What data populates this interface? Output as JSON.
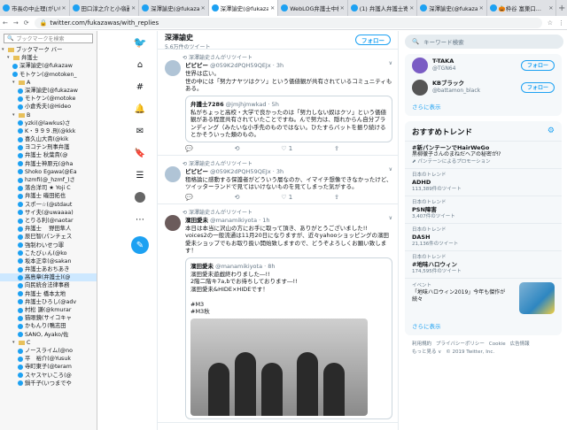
{
  "browser": {
    "tabs": [
      {
        "label": "市長の中止理(がいい"
      },
      {
        "label": "田口淳之介と小嶺麗..."
      },
      {
        "label": "深澤諭史(@fukazaw..."
      },
      {
        "label": "深澤諭史(@fukazaw..."
      },
      {
        "label": "WebLOG弁護士中村..."
      },
      {
        "label": "(1) 弁護人弁護士寄..."
      },
      {
        "label": "深澤諭史(@fukazaw..."
      },
      {
        "label": "🎃枠谷 富巣口..."
      }
    ],
    "url": "twitter.com/fukazawas/with_replies"
  },
  "bookmarks": {
    "search_placeholder": "ブックマークを検索",
    "items": [
      {
        "label": "ブックマーク バー",
        "type": "folder",
        "indent": 0
      },
      {
        "label": "弁護士",
        "type": "folder",
        "indent": 1
      },
      {
        "label": "深澤諭史(@fukazaw",
        "type": "link",
        "indent": 2
      },
      {
        "label": "モトケン(@motoken_",
        "type": "link",
        "indent": 2
      },
      {
        "label": "A",
        "type": "folder",
        "indent": 2
      },
      {
        "label": "深澤諭史(@fukazaw",
        "type": "link",
        "indent": 3
      },
      {
        "label": "モトケン(@motoke",
        "type": "link",
        "indent": 3
      },
      {
        "label": "小倉秀夫(@Hideo",
        "type": "link",
        "indent": 3
      },
      {
        "label": "B",
        "type": "folder",
        "indent": 2
      },
      {
        "label": "yzki(@lawkus)さ",
        "type": "link",
        "indent": 3
      },
      {
        "label": "K・９９９.刑(@kkk",
        "type": "link",
        "indent": 3
      },
      {
        "label": "喜久山大貴(@kik",
        "type": "link",
        "indent": 3
      },
      {
        "label": "ヨコテン刑事弁護",
        "type": "link",
        "indent": 3
      },
      {
        "label": "弁護士 秋葉貴(@",
        "type": "link",
        "indent": 3
      },
      {
        "label": "弁護士神原元(@ha",
        "type": "link",
        "indent": 3
      },
      {
        "label": "Shoko Egawa(@Ea",
        "type": "link",
        "indent": 3
      },
      {
        "label": "hzmfi(@_hzmf_)さ",
        "type": "link",
        "indent": 3
      },
      {
        "label": "落合洋司 ★ Yoji C",
        "type": "link",
        "indent": 3
      },
      {
        "label": "弁護士 磯田拓也",
        "type": "link",
        "indent": 3
      },
      {
        "label": "スポ一☆(@stdaut",
        "type": "link",
        "indent": 3
      },
      {
        "label": "サイ夫(@uwaaaa)",
        "type": "link",
        "indent": 3
      },
      {
        "label": "とりる利(@naotar",
        "type": "link",
        "indent": 3
      },
      {
        "label": "弁護士 　野田隼人",
        "type": "link",
        "indent": 3
      },
      {
        "label": "辰巳智(パンチェス",
        "type": "link",
        "indent": 3
      },
      {
        "label": "強制わいせつ罪",
        "type": "link",
        "indent": 3
      },
      {
        "label": "こたびぃん(@ko",
        "type": "link",
        "indent": 3
      },
      {
        "label": "坂本正幸(@sakan",
        "type": "link",
        "indent": 3
      },
      {
        "label": "弁護士あおちあき",
        "type": "link",
        "indent": 3
      },
      {
        "label": "高島章(弁護士)(@",
        "type": "link",
        "indent": 3,
        "selected": true
      },
      {
        "label": "向民統合法律事務",
        "type": "link",
        "indent": 3
      },
      {
        "label": "弁護士 橋本太地",
        "type": "link",
        "indent": 3
      },
      {
        "label": "弁護士ひろし(@adv",
        "type": "link",
        "indent": 3
      },
      {
        "label": "村松 謙(@kmurar",
        "type": "link",
        "indent": 3
      },
      {
        "label": "猫眼鏡(サイコキャ",
        "type": "link",
        "indent": 3
      },
      {
        "label": "かもんり(鴨志田",
        "type": "link",
        "indent": 3
      },
      {
        "label": "SANO, Ayako/佐",
        "type": "link",
        "indent": 3
      },
      {
        "label": "C",
        "type": "folder",
        "indent": 2
      },
      {
        "label": "ノースライム(@no",
        "type": "link",
        "indent": 3
      },
      {
        "label": "平　裕介(@Yusuk",
        "type": "link",
        "indent": 3
      },
      {
        "label": "寺町東子(@teram",
        "type": "link",
        "indent": 3
      },
      {
        "label": "スヤスヤいころ(@",
        "type": "link",
        "indent": 3
      },
      {
        "label": "鍋千子(いつまでや",
        "type": "link",
        "indent": 3
      }
    ]
  },
  "profile": {
    "name": "深澤諭史",
    "tweet_count": "5.6万件のツイート",
    "follow_label": "フォロー"
  },
  "tweets": [
    {
      "retweet_by": "深澤諭史さんがリツイート",
      "name": "ピピピー",
      "handle": "@059K2dPQH59QEJx · 3h",
      "text": "世界は広い。\n世の中には「努力ナヤツはクソ」という価値観が共有されているコミュニティもある。",
      "quote": {
        "name": "弁護士7286",
        "handle": "@jmjhjmwkad · 5h",
        "text": "私がちょっと高校・大学で良かったのは「努力しない奴はクソ」という価値観がある程度共有されていたことですね。んで努力は、隠れからん自分ブランディング（みたいな小手先のものではない。ひたすらバットを振り続けるとかそういった類のもの。"
      },
      "reply": "",
      "retweet": "",
      "like": "1"
    },
    {
      "retweet_by": "深澤諭史さんがリツイート",
      "name": "ピピピー",
      "handle": "@059K2dPQH59QEJx · 3h",
      "text": "租格論に感動する保護者がどういう層なのか、イマイチ想像できなかったけど、ツイッターランドで見てはいけないものを見てしまった気がする。",
      "reply": "",
      "retweet": "",
      "like": "1"
    },
    {
      "retweet_by": "深澤諭史さんがリツイート",
      "name": "濱田愛未",
      "handle": "@manamikiyota · 1h",
      "text": "本日は本当に沢山の方にお手に取って頂き、ありがとうございました!!\nvoices2の一般流通は11月20日になりますが、近々yahooショッピングの濱田愛未ショップでもお取り扱い開始致しますので、どうぞよろしくお願い致します！",
      "quote": {
        "name": "濱田愛未",
        "handle": "@manamikiyota · 8h",
        "text": "濱田愛未遊戯終わりました―!!\n2階二階キ7a,bでお待ちしております―!!\n濱田愛未&HIDE×HIDEです！\n\n#M3\n#M3秋"
      }
    }
  ],
  "right": {
    "search_placeholder": "キーワード検索",
    "who_to_follow": [
      {
        "name": "T-TAKA",
        "handle": "@TGN64",
        "follow": "フォロー",
        "color": "#7a5cc4"
      },
      {
        "name": "KBブラック",
        "handle": "@battamon_black",
        "follow": "フォロー",
        "color": "#555555"
      }
    ],
    "more_label": "さらに表示",
    "trends_title": "おすすめトレンド",
    "trends": [
      {
        "name": "#新パンテーンでHairWeGo",
        "sub": "黒柳徹子さんのまねだヘアの秘密が⁉",
        "promo": "パンテーンによるプロモーション"
      },
      {
        "ctx": "日本のトレンド",
        "name": "ADHD",
        "count": "113,389件のツイート"
      },
      {
        "ctx": "日本のトレンド",
        "name": "PSN障害",
        "count": "3,407件のツイート"
      },
      {
        "ctx": "日本のトレンド",
        "name": "DASH",
        "count": "21,136件のツイート"
      },
      {
        "ctx": "日本のトレンド",
        "name": "#地味ハロウィン",
        "count": "174,595件のツイート"
      }
    ],
    "event": {
      "ctx": "イベント",
      "text": "「地味ハロウィン2019」今年も傑作が続々"
    },
    "trends_more": "さらに表示",
    "footer": [
      "利用規約",
      "プライバシーポリシー",
      "Cookie",
      "広告情報",
      "もっと見る ∨",
      "© 2019 Twitter, Inc."
    ]
  }
}
